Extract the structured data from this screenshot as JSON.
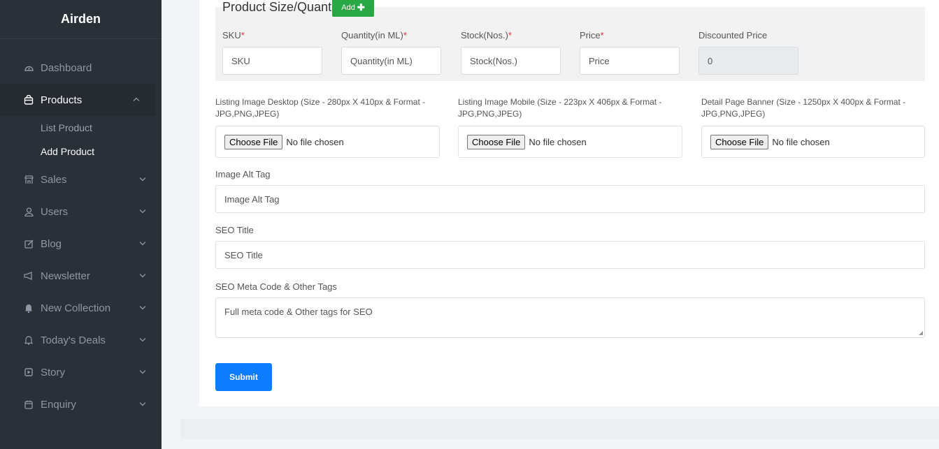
{
  "sidebar": {
    "brand": "Airden",
    "items": [
      {
        "label": "Dashboard",
        "icon": "palette-icon"
      },
      {
        "label": "Products",
        "icon": "bag-icon",
        "active": true
      },
      {
        "label": "Sales",
        "icon": "shop-icon"
      },
      {
        "label": "Users",
        "icon": "user-icon"
      },
      {
        "label": "Blog",
        "icon": "edit-icon"
      },
      {
        "label": "Newsletter",
        "icon": "megaphone-icon"
      },
      {
        "label": "New Collection",
        "icon": "bell-filled-icon"
      },
      {
        "label": "Today's Deals",
        "icon": "bell-icon"
      },
      {
        "label": "Story",
        "icon": "play-square-icon"
      },
      {
        "label": "Enquiry",
        "icon": "calendar-icon"
      }
    ],
    "products_sub": [
      "List Product",
      "Add Product"
    ]
  },
  "product_size": {
    "title": "Product Size/Quantity",
    "add_label": "Add",
    "required_mark": "*",
    "columns": [
      {
        "label": "SKU",
        "required": true,
        "placeholder": "SKU"
      },
      {
        "label": "Quantity(in ML)",
        "required": true,
        "placeholder": "Quantity(in ML)"
      },
      {
        "label": "Stock(Nos.)",
        "required": true,
        "placeholder": "Stock(Nos.)"
      },
      {
        "label": "Price",
        "required": true,
        "placeholder": "Price"
      },
      {
        "label": "Discounted Price",
        "required": false,
        "value": "0"
      }
    ]
  },
  "files": {
    "choose_label": "Choose File",
    "no_file": "No file chosen",
    "items": [
      {
        "label": "Listing Image Desktop (Size - 280px X 410px & Format - JPG,PNG,JPEG)"
      },
      {
        "label": "Listing Image Mobile (Size - 223px X 406px & Format - JPG,PNG,JPEG)"
      },
      {
        "label": "Detail Page Banner (Size - 1250px X 400px & Format - JPG,PNG,JPEG)"
      }
    ]
  },
  "image_alt": {
    "label": "Image Alt Tag",
    "placeholder": "Image Alt Tag"
  },
  "seo_title": {
    "label": "SEO Title",
    "placeholder": "SEO Title"
  },
  "seo_meta": {
    "label": "SEO Meta Code & Other Tags",
    "placeholder": "Full meta code & Other tags for SEO"
  },
  "submit_label": "Submit",
  "colors": {
    "sidebar": "#2a3038",
    "accent": "#0d7dfd",
    "add": "#28a745",
    "required": "#dc3545"
  }
}
